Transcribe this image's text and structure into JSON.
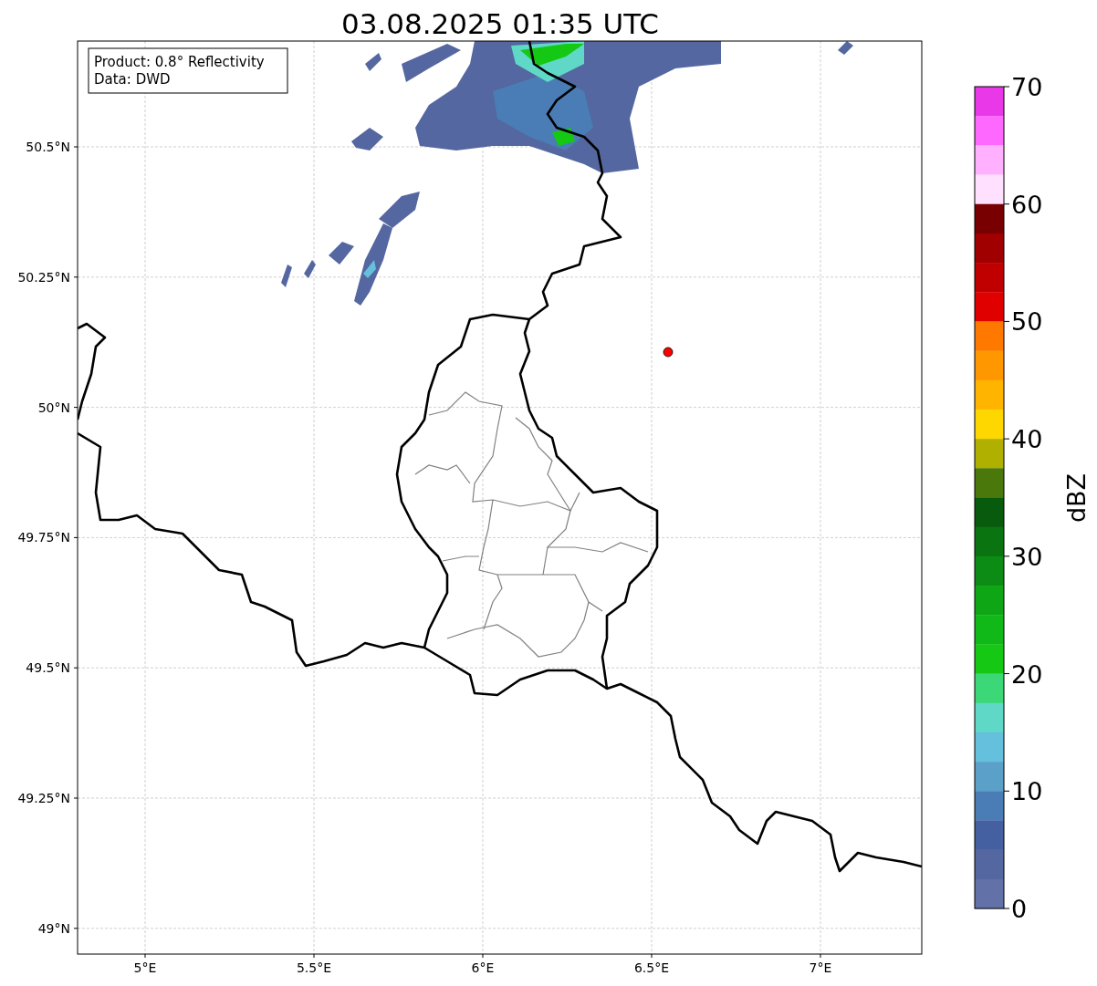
{
  "title": "03.08.2025 01:35 UTC",
  "annotation": [
    "Product: 0.8° Reflectivity",
    "Data: DWD"
  ],
  "map": {
    "xticks": [
      "5°E",
      "5.5°E",
      "6°E",
      "6.5°E",
      "7°E"
    ],
    "yticks": [
      "50.5°N",
      "50.25°N",
      "50°N",
      "49.75°N",
      "49.5°N",
      "49.25°N",
      "49°N"
    ]
  },
  "colorbar": {
    "label": "dBZ",
    "ticks": [
      "70",
      "60",
      "50",
      "40",
      "30",
      "20",
      "10",
      "0"
    ],
    "bins": [
      {
        "color": "#e838e8"
      },
      {
        "color": "#ff68ff"
      },
      {
        "color": "#ffb0ff"
      },
      {
        "color": "#ffe0ff"
      },
      {
        "color": "#780000"
      },
      {
        "color": "#a00000"
      },
      {
        "color": "#c00000"
      },
      {
        "color": "#e00000"
      },
      {
        "color": "#ff7800"
      },
      {
        "color": "#ff9800"
      },
      {
        "color": "#ffb400"
      },
      {
        "color": "#ffd700"
      },
      {
        "color": "#b0b000"
      },
      {
        "color": "#4a780a"
      },
      {
        "color": "#085a0c"
      },
      {
        "color": "#0a7410"
      },
      {
        "color": "#0c8c14"
      },
      {
        "color": "#0ea614"
      },
      {
        "color": "#10b818"
      },
      {
        "color": "#14c814"
      },
      {
        "color": "#3cd878"
      },
      {
        "color": "#60d8c8"
      },
      {
        "color": "#64c0dc"
      },
      {
        "color": "#5ba0c8"
      },
      {
        "color": "#4a7db5"
      },
      {
        "color": "#4560a0"
      },
      {
        "color": "#5467a0"
      },
      {
        "color": "#6272a8"
      }
    ]
  }
}
